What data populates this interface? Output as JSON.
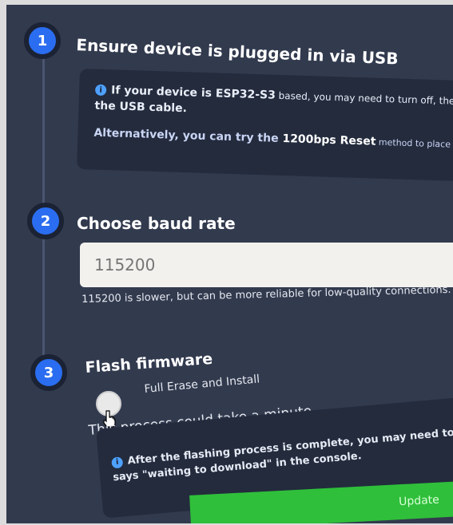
{
  "steps": [
    {
      "number": "1",
      "title": "Ensure device is plugged in via USB"
    },
    {
      "number": "2",
      "title": "Choose baud rate"
    },
    {
      "number": "3",
      "title": "Flash firmware"
    }
  ],
  "step1_info": {
    "line1_prefix": "If your device is ",
    "line1_chip": "ESP32-S3",
    "line1_suffix": " based, you may need to turn off, then press",
    "line2": "the USB cable.",
    "line3_prefix": "Alternatively, you can try the ",
    "line3_method": "1200bps Reset",
    "line3_suffix": " method to place the device"
  },
  "baud": {
    "placeholder": "115200",
    "helper": "115200 is slower, but can be more reliable for low-quality connections."
  },
  "flash": {
    "option_label": "Full Erase and Install",
    "process_note": "This process could take a minute.",
    "info_line1": "After the flashing process is complete, you may need to press th",
    "info_line2": "says \"waiting to download\" in the console.",
    "update_label": "Update"
  },
  "icons": [
    "info-icon",
    "hand-cursor-icon",
    "radio-button"
  ]
}
